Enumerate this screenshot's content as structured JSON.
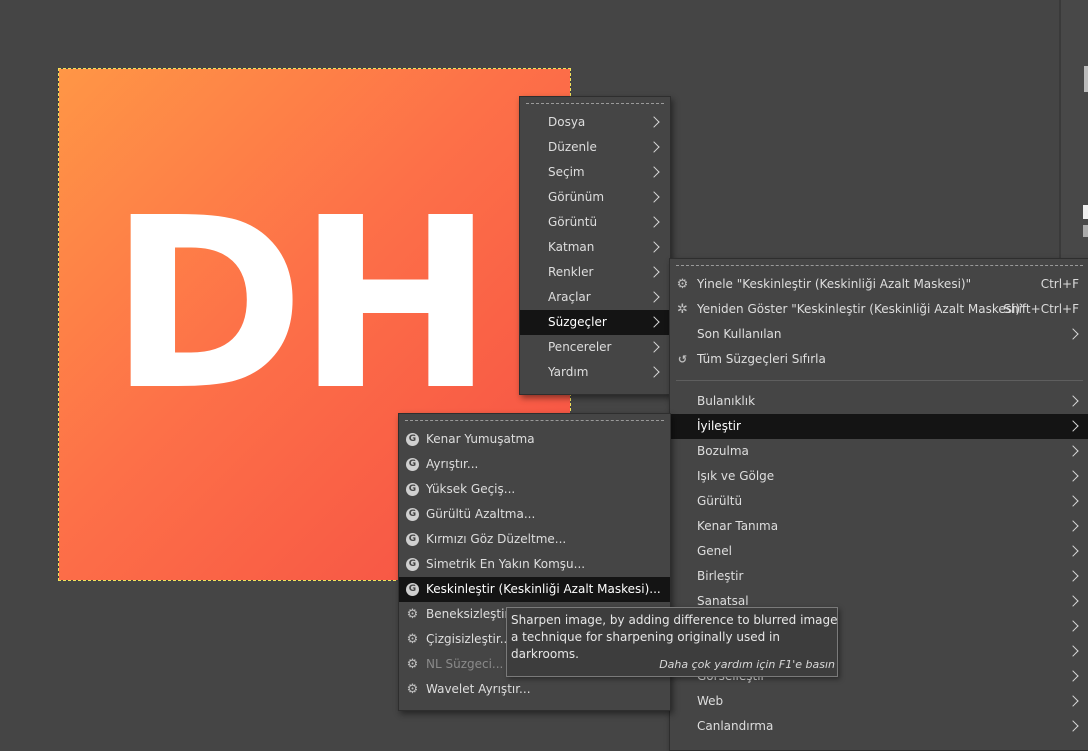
{
  "canvas": {
    "logo_text": "DH",
    "gradient_colors": [
      "#ff9646",
      "#f54e44"
    ],
    "selection_outline_color": "#f2e35a"
  },
  "main_menu": {
    "items": [
      {
        "label": "Dosya"
      },
      {
        "label": "Düzenle"
      },
      {
        "label": "Seçim"
      },
      {
        "label": "Görünüm"
      },
      {
        "label": "Görüntü"
      },
      {
        "label": "Katman"
      },
      {
        "label": "Renkler"
      },
      {
        "label": "Araçlar"
      },
      {
        "label": "Süzgeçler",
        "highlighted": true
      },
      {
        "label": "Pencereler"
      },
      {
        "label": "Yardım"
      }
    ]
  },
  "filters_menu": {
    "top_items": [
      {
        "label": "Yinele \"Keskinleştir (Keskinliği Azalt Maskesi)\"",
        "shortcut": "Ctrl+F",
        "icon": "repeat-filter-icon"
      },
      {
        "label": "Yeniden Göster \"Keskinleştir (Keskinliği Azalt Maskesi)\"",
        "shortcut": "Shift+Ctrl+F",
        "icon": "reshow-filter-icon"
      },
      {
        "label": "Son Kullanılan",
        "submenu": true
      },
      {
        "label": "Tüm Süzgeçleri Sıfırla",
        "icon": "reset-icon"
      }
    ],
    "categories": [
      {
        "label": "Bulanıklık"
      },
      {
        "label": "İyileştir",
        "highlighted": true
      },
      {
        "label": "Bozulma"
      },
      {
        "label": "Işık ve Gölge"
      },
      {
        "label": "Gürültü"
      },
      {
        "label": "Kenar Tanıma"
      },
      {
        "label": "Genel"
      },
      {
        "label": "Birleştir"
      },
      {
        "label": "Sanatsal"
      },
      {
        "label": ""
      },
      {
        "label": ""
      },
      {
        "label": "Görselleştir"
      },
      {
        "label": "Web"
      },
      {
        "label": "Canlandırma"
      }
    ]
  },
  "enhance_menu": {
    "items": [
      {
        "label": "Kenar Yumuşatma",
        "icon": "gegl-icon"
      },
      {
        "label": "Ayrıştır...",
        "icon": "gegl-icon"
      },
      {
        "label": "Yüksek Geçiş...",
        "icon": "gegl-icon"
      },
      {
        "label": "Gürültü Azaltma...",
        "icon": "gegl-icon"
      },
      {
        "label": "Kırmızı Göz Düzeltme...",
        "icon": "gegl-icon"
      },
      {
        "label": "Simetrik En Yakın Komşu...",
        "icon": "gegl-icon"
      },
      {
        "label": "Keskinleştir (Keskinliği Azalt Maskesi)...",
        "icon": "gegl-icon",
        "highlighted": true
      },
      {
        "label": "Beneksizleştir...",
        "icon": "plugin-icon"
      },
      {
        "label": "Çizgisizleştir...",
        "icon": "plugin-icon"
      },
      {
        "label": "NL Süzgeci...",
        "icon": "plugin-icon",
        "disabled": true
      },
      {
        "label": "Wavelet Ayrıştır...",
        "icon": "plugin-icon"
      }
    ]
  },
  "tooltip": {
    "text": "Sharpen image, by adding difference to blurred image, a technique for sharpening originally used in darkrooms.",
    "hint": "Daha çok yardım için F1'e basın"
  }
}
